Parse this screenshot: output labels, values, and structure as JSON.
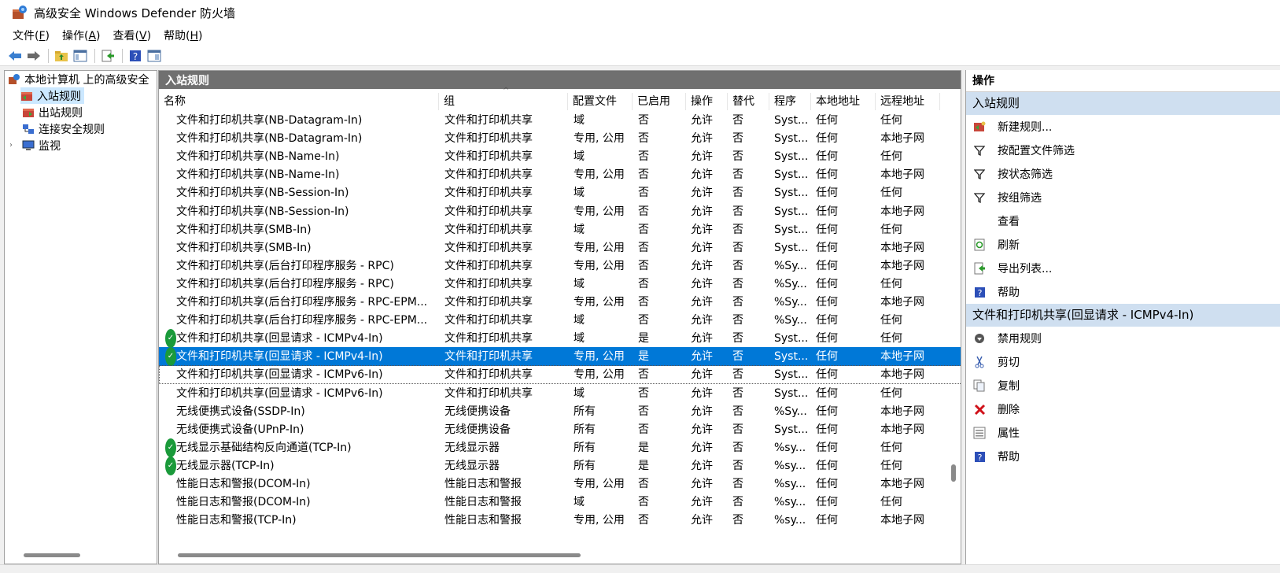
{
  "window": {
    "title": "高级安全 Windows Defender 防火墙"
  },
  "menu": [
    {
      "label": "文件(",
      "acc": "F",
      "end": ")"
    },
    {
      "label": "操作(",
      "acc": "A",
      "end": ")"
    },
    {
      "label": "查看(",
      "acc": "V",
      "end": ")"
    },
    {
      "label": "帮助(",
      "acc": "H",
      "end": ")"
    }
  ],
  "toolbar": {
    "icons": [
      "back-arrow-icon",
      "forward-arrow-icon",
      "up-folder-icon",
      "show-hide-tree-icon",
      "export-list-icon",
      "help-icon",
      "show-hide-action-pane-icon"
    ]
  },
  "tree": {
    "root": "本地计算机 上的高级安全",
    "items": [
      "入站规则",
      "出站规则",
      "连接安全规则",
      "监视"
    ]
  },
  "center": {
    "header": "入站规则",
    "columns": [
      "名称",
      "组",
      "配置文件",
      "已启用",
      "操作",
      "替代",
      "程序",
      "本地地址",
      "远程地址"
    ],
    "rows": [
      {
        "name": "文件和打印机共享(NB-Datagram-In)",
        "group": "文件和打印机共享",
        "profile": "域",
        "enabled": "否",
        "action": "允许",
        "override": "否",
        "program": "Syst...",
        "local": "任何",
        "remote": "任何",
        "check": false
      },
      {
        "name": "文件和打印机共享(NB-Datagram-In)",
        "group": "文件和打印机共享",
        "profile": "专用, 公用",
        "enabled": "否",
        "action": "允许",
        "override": "否",
        "program": "Syst...",
        "local": "任何",
        "remote": "本地子网",
        "check": false
      },
      {
        "name": "文件和打印机共享(NB-Name-In)",
        "group": "文件和打印机共享",
        "profile": "域",
        "enabled": "否",
        "action": "允许",
        "override": "否",
        "program": "Syst...",
        "local": "任何",
        "remote": "任何",
        "check": false
      },
      {
        "name": "文件和打印机共享(NB-Name-In)",
        "group": "文件和打印机共享",
        "profile": "专用, 公用",
        "enabled": "否",
        "action": "允许",
        "override": "否",
        "program": "Syst...",
        "local": "任何",
        "remote": "本地子网",
        "check": false
      },
      {
        "name": "文件和打印机共享(NB-Session-In)",
        "group": "文件和打印机共享",
        "profile": "域",
        "enabled": "否",
        "action": "允许",
        "override": "否",
        "program": "Syst...",
        "local": "任何",
        "remote": "任何",
        "check": false
      },
      {
        "name": "文件和打印机共享(NB-Session-In)",
        "group": "文件和打印机共享",
        "profile": "专用, 公用",
        "enabled": "否",
        "action": "允许",
        "override": "否",
        "program": "Syst...",
        "local": "任何",
        "remote": "本地子网",
        "check": false
      },
      {
        "name": "文件和打印机共享(SMB-In)",
        "group": "文件和打印机共享",
        "profile": "域",
        "enabled": "否",
        "action": "允许",
        "override": "否",
        "program": "Syst...",
        "local": "任何",
        "remote": "任何",
        "check": false
      },
      {
        "name": "文件和打印机共享(SMB-In)",
        "group": "文件和打印机共享",
        "profile": "专用, 公用",
        "enabled": "否",
        "action": "允许",
        "override": "否",
        "program": "Syst...",
        "local": "任何",
        "remote": "本地子网",
        "check": false
      },
      {
        "name": "文件和打印机共享(后台打印程序服务 - RPC)",
        "group": "文件和打印机共享",
        "profile": "专用, 公用",
        "enabled": "否",
        "action": "允许",
        "override": "否",
        "program": "%Sy...",
        "local": "任何",
        "remote": "本地子网",
        "check": false
      },
      {
        "name": "文件和打印机共享(后台打印程序服务 - RPC)",
        "group": "文件和打印机共享",
        "profile": "域",
        "enabled": "否",
        "action": "允许",
        "override": "否",
        "program": "%Sy...",
        "local": "任何",
        "remote": "任何",
        "check": false
      },
      {
        "name": "文件和打印机共享(后台打印程序服务 - RPC-EPM...",
        "group": "文件和打印机共享",
        "profile": "专用, 公用",
        "enabled": "否",
        "action": "允许",
        "override": "否",
        "program": "%Sy...",
        "local": "任何",
        "remote": "本地子网",
        "check": false
      },
      {
        "name": "文件和打印机共享(后台打印程序服务 - RPC-EPM...",
        "group": "文件和打印机共享",
        "profile": "域",
        "enabled": "否",
        "action": "允许",
        "override": "否",
        "program": "%Sy...",
        "local": "任何",
        "remote": "任何",
        "check": false
      },
      {
        "name": "文件和打印机共享(回显请求 - ICMPv4-In)",
        "group": "文件和打印机共享",
        "profile": "域",
        "enabled": "是",
        "action": "允许",
        "override": "否",
        "program": "Syst...",
        "local": "任何",
        "remote": "任何",
        "check": true
      },
      {
        "name": "文件和打印机共享(回显请求 - ICMPv4-In)",
        "group": "文件和打印机共享",
        "profile": "专用, 公用",
        "enabled": "是",
        "action": "允许",
        "override": "否",
        "program": "Syst...",
        "local": "任何",
        "remote": "本地子网",
        "check": true,
        "selected": true
      },
      {
        "name": "文件和打印机共享(回显请求 - ICMPv6-In)",
        "group": "文件和打印机共享",
        "profile": "专用, 公用",
        "enabled": "否",
        "action": "允许",
        "override": "否",
        "program": "Syst...",
        "local": "任何",
        "remote": "本地子网",
        "check": false,
        "focus": true
      },
      {
        "name": "文件和打印机共享(回显请求 - ICMPv6-In)",
        "group": "文件和打印机共享",
        "profile": "域",
        "enabled": "否",
        "action": "允许",
        "override": "否",
        "program": "Syst...",
        "local": "任何",
        "remote": "任何",
        "check": false
      },
      {
        "name": "无线便携式设备(SSDP-In)",
        "group": "无线便携设备",
        "profile": "所有",
        "enabled": "否",
        "action": "允许",
        "override": "否",
        "program": "%Sy...",
        "local": "任何",
        "remote": "本地子网",
        "check": false
      },
      {
        "name": "无线便携式设备(UPnP-In)",
        "group": "无线便携设备",
        "profile": "所有",
        "enabled": "否",
        "action": "允许",
        "override": "否",
        "program": "Syst...",
        "local": "任何",
        "remote": "本地子网",
        "check": false
      },
      {
        "name": "无线显示基础结构反向通道(TCP-In)",
        "group": "无线显示器",
        "profile": "所有",
        "enabled": "是",
        "action": "允许",
        "override": "否",
        "program": "%sy...",
        "local": "任何",
        "remote": "任何",
        "check": true
      },
      {
        "name": "无线显示器(TCP-In)",
        "group": "无线显示器",
        "profile": "所有",
        "enabled": "是",
        "action": "允许",
        "override": "否",
        "program": "%sy...",
        "local": "任何",
        "remote": "任何",
        "check": true
      },
      {
        "name": "性能日志和警报(DCOM-In)",
        "group": "性能日志和警报",
        "profile": "专用, 公用",
        "enabled": "否",
        "action": "允许",
        "override": "否",
        "program": "%sy...",
        "local": "任何",
        "remote": "本地子网",
        "check": false
      },
      {
        "name": "性能日志和警报(DCOM-In)",
        "group": "性能日志和警报",
        "profile": "域",
        "enabled": "否",
        "action": "允许",
        "override": "否",
        "program": "%sy...",
        "local": "任何",
        "remote": "任何",
        "check": false
      },
      {
        "name": "性能日志和警报(TCP-In)",
        "group": "性能日志和警报",
        "profile": "专用, 公用",
        "enabled": "否",
        "action": "允许",
        "override": "否",
        "program": "%sy...",
        "local": "任何",
        "remote": "本地子网",
        "check": false
      }
    ]
  },
  "actions": {
    "title": "操作",
    "section1": "入站规则",
    "items1": [
      {
        "label": "新建规则...",
        "icon": "new-rule-icon"
      },
      {
        "label": "按配置文件筛选",
        "icon": "filter-icon"
      },
      {
        "label": "按状态筛选",
        "icon": "filter-icon"
      },
      {
        "label": "按组筛选",
        "icon": "filter-icon"
      },
      {
        "label": "查看",
        "icon": ""
      },
      {
        "label": "刷新",
        "icon": "refresh-icon"
      },
      {
        "label": "导出列表...",
        "icon": "export-icon"
      },
      {
        "label": "帮助",
        "icon": "help-icon"
      }
    ],
    "section2": "文件和打印机共享(回显请求 - ICMPv4-In)",
    "items2": [
      {
        "label": "禁用规则",
        "icon": "disable-rule-icon"
      },
      {
        "label": "剪切",
        "icon": "cut-icon"
      },
      {
        "label": "复制",
        "icon": "copy-icon"
      },
      {
        "label": "删除",
        "icon": "delete-icon"
      },
      {
        "label": "属性",
        "icon": "properties-icon"
      },
      {
        "label": "帮助",
        "icon": "help-icon"
      }
    ]
  },
  "colors": {
    "selection": "#0078d7",
    "accent_check": "#1a9a3a",
    "section_bg": "#cfdff0",
    "pane_header": "#707070"
  }
}
